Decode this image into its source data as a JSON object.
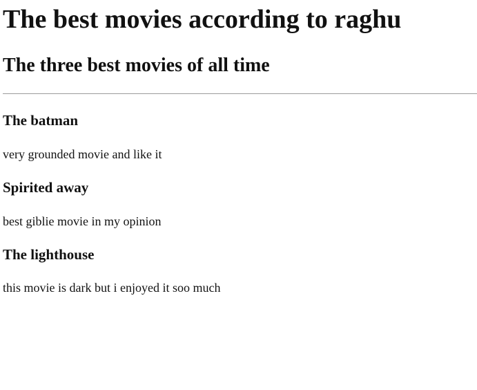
{
  "page": {
    "title": "The best movies according to raghu",
    "subtitle": "The three best movies of all time"
  },
  "movies": [
    {
      "title": "The batman",
      "description": "very grounded movie and like it"
    },
    {
      "title": "Spirited away",
      "description": "best giblie movie in my opinion"
    },
    {
      "title": "The lighthouse",
      "description": "this movie is dark but i enjoyed it soo much"
    }
  ],
  "colors": {
    "background": "#ffffff",
    "text": "#111111",
    "divider": "#9a9a9a"
  }
}
